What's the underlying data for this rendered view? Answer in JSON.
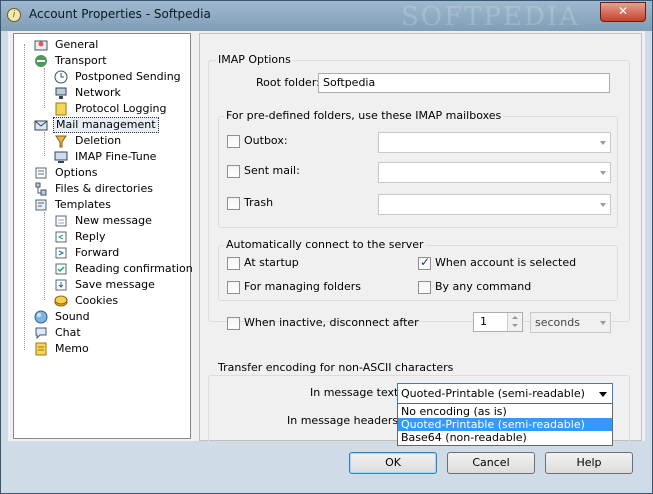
{
  "window": {
    "title": "Account Properties - Softpedia",
    "watermark": "SOFTPEDIA",
    "close_glyph": "✕"
  },
  "tree": {
    "items": [
      {
        "label": "General",
        "icon": "general-icon",
        "level": 1
      },
      {
        "label": "Transport",
        "icon": "transport-icon",
        "level": 1
      },
      {
        "label": "Postponed Sending",
        "icon": "clock-icon",
        "level": 2
      },
      {
        "label": "Network",
        "icon": "network-icon",
        "level": 2
      },
      {
        "label": "Protocol Logging",
        "icon": "log-icon",
        "level": 2
      },
      {
        "label": "Mail management",
        "icon": "mail-management-icon",
        "level": 1,
        "selected": true
      },
      {
        "label": "Deletion",
        "icon": "deletion-icon",
        "level": 2
      },
      {
        "label": "IMAP Fine-Tune",
        "icon": "imap-icon",
        "level": 2
      },
      {
        "label": "Options",
        "icon": "options-icon",
        "level": 1
      },
      {
        "label": "Files & directories",
        "icon": "folders-icon",
        "level": 1
      },
      {
        "label": "Templates",
        "icon": "templates-icon",
        "level": 1
      },
      {
        "label": "New message",
        "icon": "new-message-icon",
        "level": 2
      },
      {
        "label": "Reply",
        "icon": "reply-icon",
        "level": 2
      },
      {
        "label": "Forward",
        "icon": "forward-icon",
        "level": 2
      },
      {
        "label": "Reading confirmation",
        "icon": "reading-confirmation-icon",
        "level": 2
      },
      {
        "label": "Save message",
        "icon": "save-icon",
        "level": 2
      },
      {
        "label": "Cookies",
        "icon": "cookies-icon",
        "level": 2
      },
      {
        "label": "Sound",
        "icon": "sound-icon",
        "level": 1
      },
      {
        "label": "Chat",
        "icon": "chat-icon",
        "level": 1
      },
      {
        "label": "Memo",
        "icon": "memo-icon",
        "level": 1
      }
    ]
  },
  "imap": {
    "group_label": "IMAP Options",
    "root_folder_label": "Root folder:",
    "root_folder_value": "Softpedia"
  },
  "predefined": {
    "group_label": "For pre-defined folders, use these IMAP mailboxes",
    "outbox_label": "Outbox:",
    "sent_label": "Sent mail:",
    "trash_label": "Trash"
  },
  "autoconnect": {
    "group_label": "Automatically connect to the server",
    "at_startup": "At startup",
    "when_selected": "When account is selected",
    "managing_folders": "For managing folders",
    "by_command": "By any command",
    "when_inactive": "When inactive, disconnect after",
    "inactive_value": "1",
    "inactive_unit": "seconds"
  },
  "encoding": {
    "group_label": "Transfer encoding for non-ASCII characters",
    "text_label": "In message text:",
    "text_value": "Quoted-Printable (semi-readable)",
    "headers_label": "In message headers:",
    "options": [
      "No encoding (as is)",
      "Quoted-Printable (semi-readable)",
      "Base64 (non-readable)"
    ]
  },
  "buttons": {
    "ok": "OK",
    "cancel": "Cancel",
    "help": "Help"
  },
  "colors": {
    "highlight": "#3399ff",
    "titlebar": "#8fa9c0"
  }
}
